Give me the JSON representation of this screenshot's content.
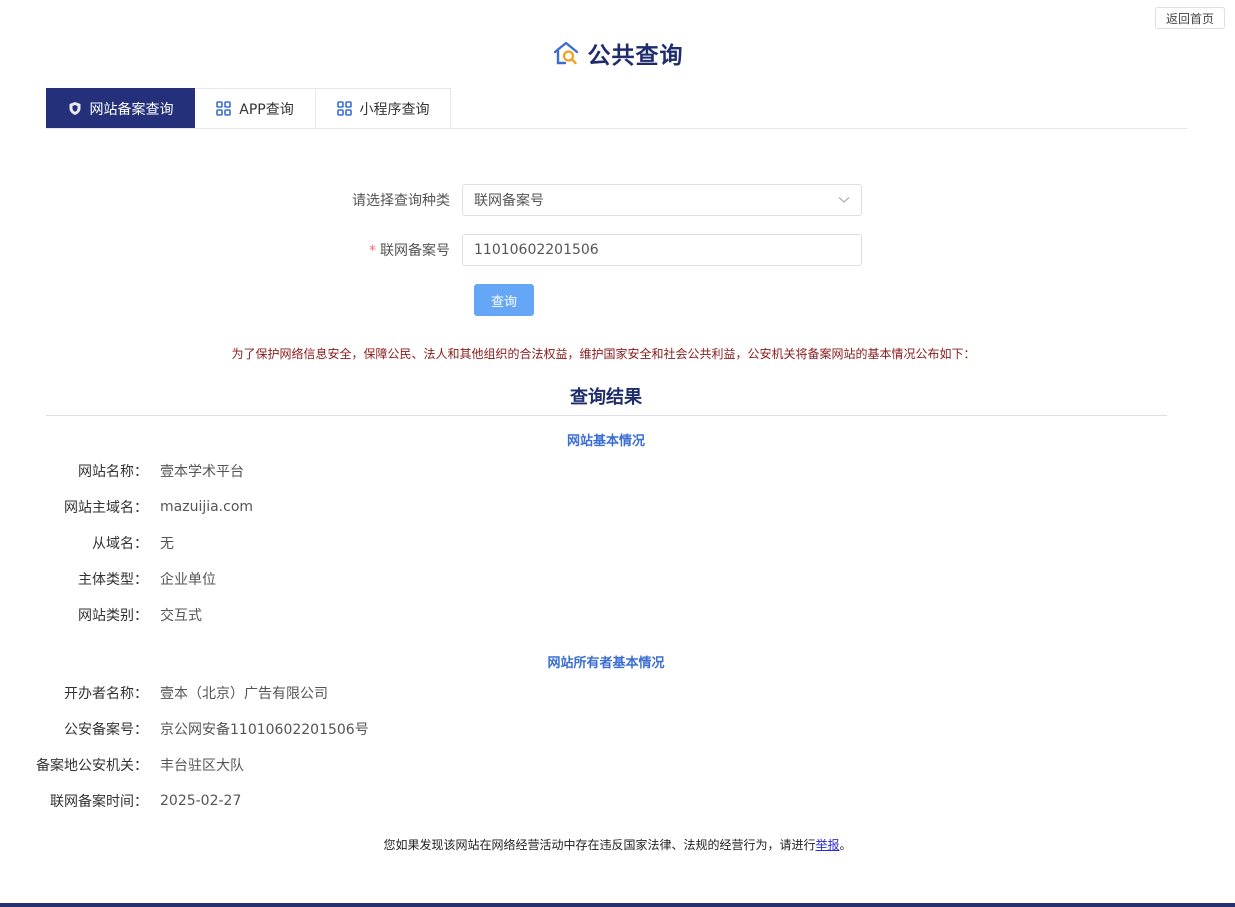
{
  "header": {
    "back_button": "返回首页",
    "title": "公共查询",
    "logo_icon": "house-search-icon"
  },
  "tabs": [
    {
      "label": "网站备案查询",
      "icon": "shield-icon",
      "active": true
    },
    {
      "label": "APP查询",
      "icon": "grid-icon",
      "active": false
    },
    {
      "label": "小程序查询",
      "icon": "grid-icon",
      "active": false
    }
  ],
  "form": {
    "type_label": "请选择查询种类",
    "type_value": "联网备案号",
    "number_required_mark": "*",
    "number_label": "联网备案号",
    "number_value": "11010602201506",
    "query_button": "查询"
  },
  "notice": "为了保护网络信息安全，保障公民、法人和其他组织的合法权益，维护国家安全和社会公共利益，公安机关将备案网站的基本情况公布如下：",
  "result": {
    "title": "查询结果",
    "site_section": {
      "title": "网站基本情况",
      "rows": [
        {
          "label": "网站名称：",
          "value": "壹本学术平台"
        },
        {
          "label": "网站主域名：",
          "value": "mazuijia.com"
        },
        {
          "label": "从域名：",
          "value": "无"
        },
        {
          "label": "主体类型：",
          "value": "企业单位"
        },
        {
          "label": "网站类别：",
          "value": "交互式"
        }
      ]
    },
    "owner_section": {
      "title": "网站所有者基本情况",
      "rows": [
        {
          "label": "开办者名称：",
          "value": "壹本（北京）广告有限公司"
        },
        {
          "label": "公安备案号：",
          "value": "京公网安备11010602201506号"
        },
        {
          "label": "备案地公安机关：",
          "value": "丰台驻区大队"
        },
        {
          "label": "联网备案时间：",
          "value": "2025-02-27"
        }
      ]
    }
  },
  "report": {
    "text": "您如果发现该网站在网络经营活动中存在违反国家法律、法规的经营行为，请进行",
    "link": "举报",
    "end": "。"
  },
  "colors": {
    "brand_dark": "#24307a",
    "accent_blue": "#3b6ed4",
    "button_blue": "#66a6f7",
    "notice_red": "#8b1a1a"
  }
}
